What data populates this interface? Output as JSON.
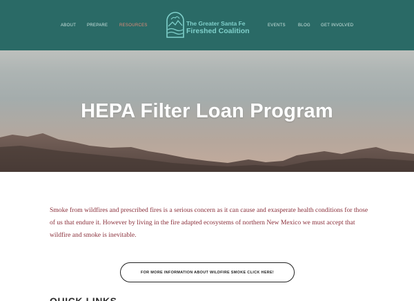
{
  "nav": {
    "left": [
      "ABOUT",
      "PREPARE",
      "RESOURCES"
    ],
    "right": [
      "EVENTS",
      "BLOG",
      "GET INVOLVED"
    ],
    "active": "RESOURCES"
  },
  "logo": {
    "line1": "The Greater Santa Fe",
    "line2": "Fireshed Coalition"
  },
  "hero": {
    "title": "HEPA Filter Loan Program"
  },
  "content": {
    "intro": "Smoke from wildfires and prescribed fires is a serious concern as it can cause and exasperate health conditions for those of us that endure it.  However by living in the fire adapted ecosystems of northern New Mexico we must accept that wildfire and smoke is inevitable.",
    "cta_label": "FOR MORE INFORMATION ABOUT WILDFIRE SMOKE CLICK HERE!",
    "section_heading": "QUICK LINKS"
  },
  "colors": {
    "header_bg": "#2a6a66",
    "nav_text": "#cfe6e2",
    "nav_active": "#e48b78",
    "logo_text": "#7fd0cb",
    "intro_text": "#8a2f3a"
  },
  "icons": [
    "fireshed-logo-icon"
  ]
}
